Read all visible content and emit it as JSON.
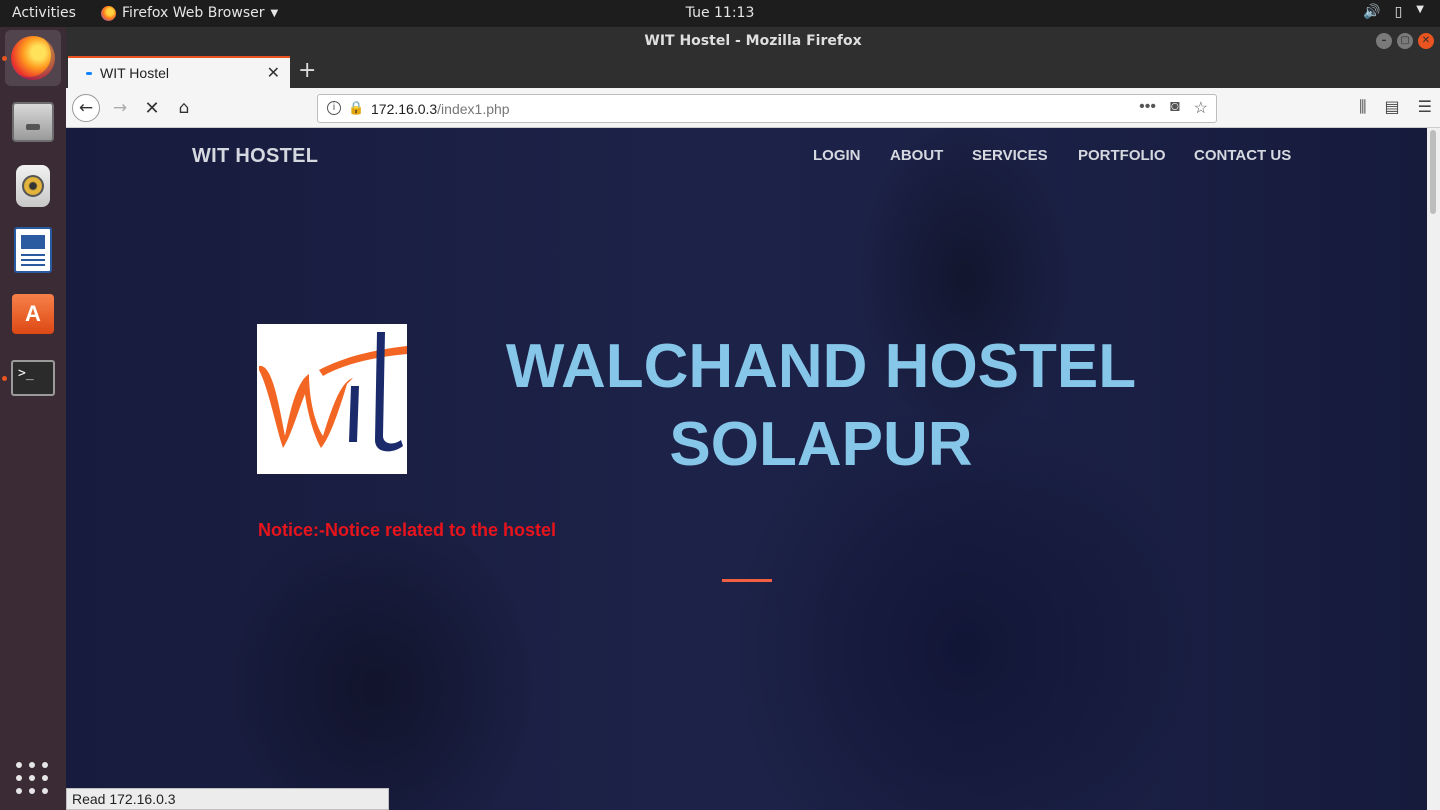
{
  "topbar": {
    "activities": "Activities",
    "app_menu": "Firefox Web Browser",
    "clock": "Tue 11:13"
  },
  "window": {
    "title": "WIT Hostel - Mozilla Firefox"
  },
  "tab": {
    "label": "WIT Hostel"
  },
  "urlbar": {
    "host": "172.16.0.3",
    "path": "/index1.php"
  },
  "page": {
    "brand": "WIT HOSTEL",
    "nav": [
      "LOGIN",
      "ABOUT",
      "SERVICES",
      "PORTFOLIO",
      "CONTACT US"
    ],
    "hero_line1": "WALCHAND HOSTEL",
    "hero_line2": "SOLAPUR",
    "notice": "Notice:-Notice related to the hostel",
    "logo_text": "wit"
  },
  "status": "Read 172.16.0.3",
  "colors": {
    "accent": "#e95420",
    "hero_text": "#86c6e8",
    "notice_text": "#e8141b",
    "divider": "#f05f40",
    "logo_orange": "#f26522",
    "logo_navy": "#1b2a6b"
  }
}
